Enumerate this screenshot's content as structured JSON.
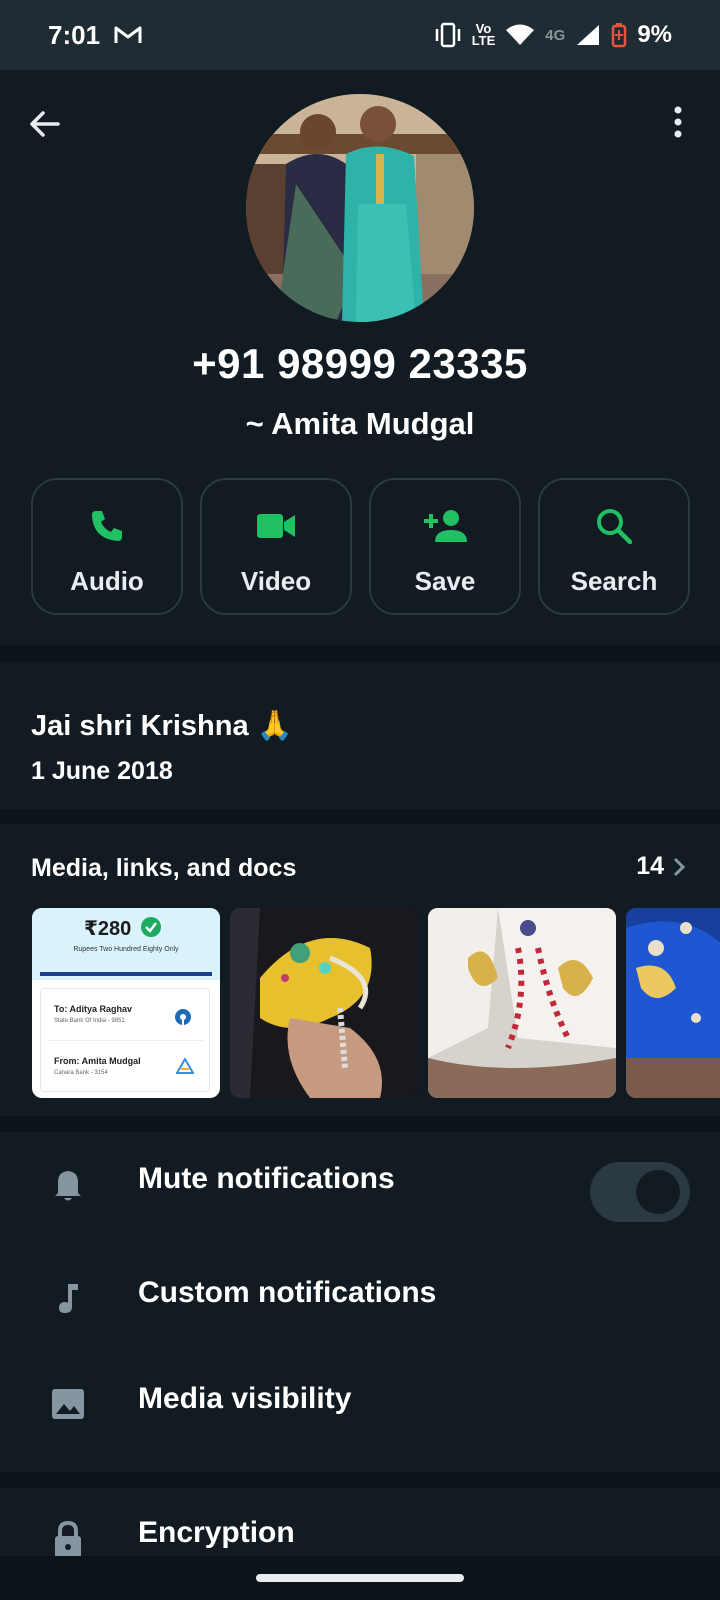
{
  "status_bar": {
    "time": "7:01",
    "volte_top": "Vo",
    "volte_bottom": "LTE",
    "network": "4G",
    "battery": "9%"
  },
  "contact": {
    "phone": "+91 98999 23335",
    "push_name": "~ Amita Mudgal"
  },
  "actions": [
    {
      "label": "Audio",
      "icon": "phone-icon"
    },
    {
      "label": "Video",
      "icon": "video-icon"
    },
    {
      "label": "Save",
      "icon": "add-person-icon"
    },
    {
      "label": "Search",
      "icon": "search-icon"
    }
  ],
  "about": {
    "text": "Jai shri Krishna 🙏",
    "date": "1 June 2018"
  },
  "media": {
    "title": "Media, links, and docs",
    "count": "14",
    "receipt": {
      "amount": "₹280",
      "amount_words": "Rupees Two Hundred Eighty Only",
      "to": "To: Aditya Raghav",
      "to_bank": "State Bank Of India - 9851",
      "from": "From: Amita Mudgal",
      "from_bank": "Canara Bank - 3154"
    }
  },
  "settings": {
    "mute": "Mute notifications",
    "custom": "Custom notifications",
    "media_visibility": "Media visibility",
    "encryption": "Encryption"
  },
  "colors": {
    "accent": "#21c063",
    "background": "#0b141a",
    "surface": "#111b21",
    "header_bar": "#1f2c34"
  }
}
